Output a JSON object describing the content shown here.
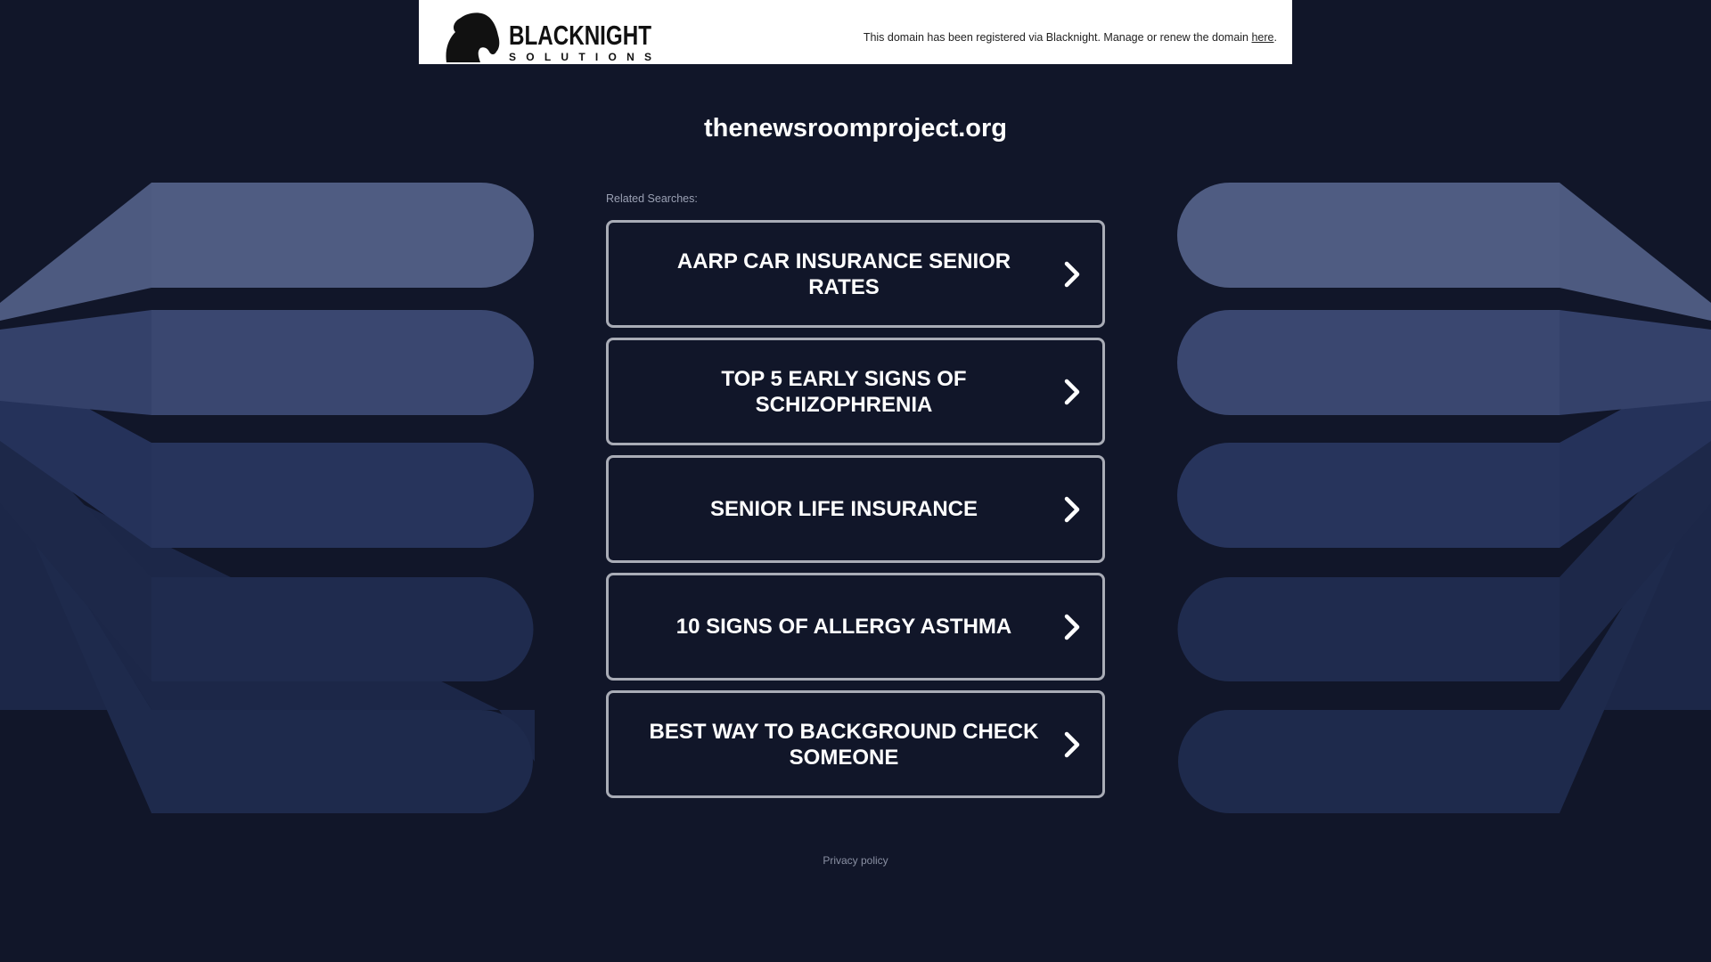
{
  "header": {
    "logo": {
      "primary": "BLACKNIGHT",
      "secondary": "SOLUTIONS"
    },
    "notice_text": "This domain has been registered via Blacknight. Manage or renew the domain ",
    "notice_link": "here",
    "notice_end": "."
  },
  "domain": "thenewsroomproject.org",
  "related_label": "Related Searches:",
  "results": [
    {
      "label": "AARP CAR INSURANCE SENIOR RATES"
    },
    {
      "label": "TOP 5 EARLY SIGNS OF SCHIZOPHRENIA"
    },
    {
      "label": "SENIOR LIFE INSURANCE"
    },
    {
      "label": "10 SIGNS OF ALLERGY ASTHMA"
    },
    {
      "label": "BEST WAY TO BACKGROUND CHECK SOMEONE"
    }
  ],
  "footer": {
    "privacy_label": "Privacy policy"
  },
  "colors": {
    "background": "#111629",
    "header": "#ffffff",
    "button_border": "#a9acb6",
    "text": "#ffffff"
  },
  "icons": {
    "logo": "horse-head-icon",
    "result_arrow": "chevron-right-icon"
  }
}
